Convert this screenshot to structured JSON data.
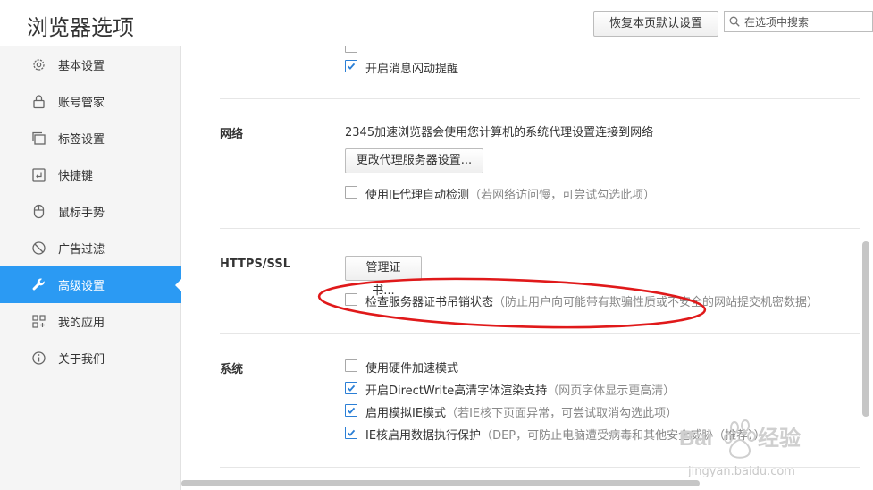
{
  "header": {
    "title": "浏览器选项",
    "restore_button": "恢复本页默认设置",
    "search_placeholder": "在选项中搜索"
  },
  "sidebar": {
    "items": [
      {
        "label": "基本设置",
        "icon": "gear-icon"
      },
      {
        "label": "账号管家",
        "icon": "lock-icon"
      },
      {
        "label": "标签设置",
        "icon": "tabs-icon"
      },
      {
        "label": "快捷键",
        "icon": "keyboard-icon"
      },
      {
        "label": "鼠标手势",
        "icon": "mouse-icon"
      },
      {
        "label": "广告过滤",
        "icon": "block-icon"
      },
      {
        "label": "高级设置",
        "icon": "wrench-icon",
        "active": true
      },
      {
        "label": "我的应用",
        "icon": "apps-icon"
      },
      {
        "label": "关于我们",
        "icon": "info-icon"
      }
    ]
  },
  "notifications": {
    "flash_reminder": {
      "label": "开启消息闪动提醒",
      "checked": true
    }
  },
  "network": {
    "label": "网络",
    "description": "2345加速浏览器会使用您计算机的系统代理设置连接到网络",
    "proxy_button": "更改代理服务器设置...",
    "ie_proxy": {
      "label": "使用IE代理自动检测",
      "hint": "（若网络访问慢，可尝试勾选此项）",
      "checked": false
    }
  },
  "https": {
    "label": "HTTPS/SSL",
    "cert_button": "管理证书...",
    "revocation": {
      "label": "检查服务器证书吊销状态",
      "hint": "（防止用户向可能带有欺骗性质或不安全的网站提交机密数据）",
      "checked": false
    }
  },
  "system": {
    "label": "系统",
    "options": [
      {
        "label": "使用硬件加速模式",
        "hint": "",
        "checked": false
      },
      {
        "label": "开启DirectWrite高清字体渲染支持",
        "hint": "（网页字体显示更高清）",
        "checked": true
      },
      {
        "label": "启用模拟IE模式",
        "hint": "（若IE核下页面异常，可尝试取消勾选此项）",
        "checked": true
      },
      {
        "label": "IE核启用数据执行保护",
        "hint": "（DEP，可防止电脑遭受病毒和其他安全威胁（推荐））",
        "checked": true
      }
    ]
  },
  "watermark": {
    "brand": "Baidu经验",
    "url": "jingyan.baidu.com"
  },
  "colors": {
    "accent": "#2b9af3",
    "annotation": "#e0191a"
  }
}
